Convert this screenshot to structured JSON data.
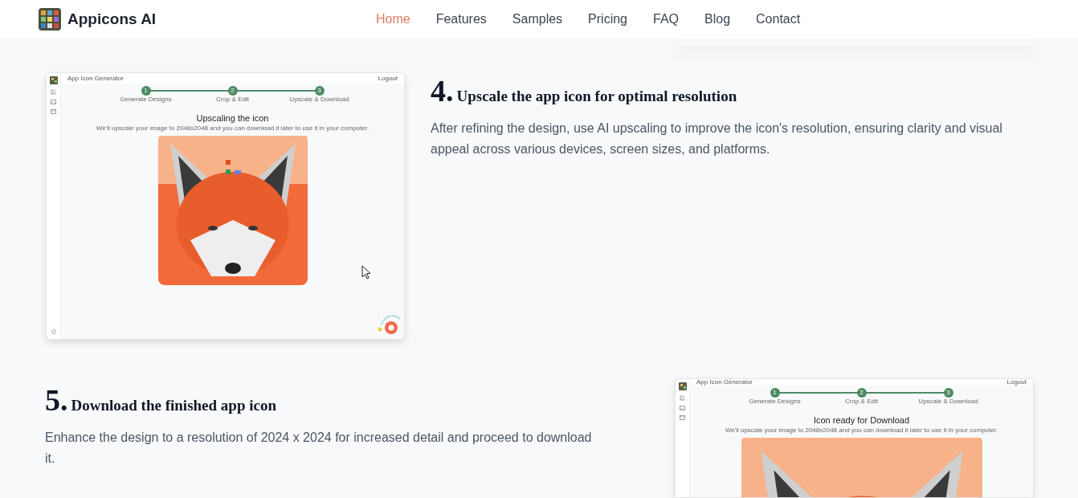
{
  "nav": {
    "brand": "Appicons AI",
    "links": [
      {
        "label": "Home",
        "selected": true
      },
      {
        "label": "Features",
        "selected": false
      },
      {
        "label": "Samples",
        "selected": false
      },
      {
        "label": "Pricing",
        "selected": false
      },
      {
        "label": "FAQ",
        "selected": false
      },
      {
        "label": "Blog",
        "selected": false
      },
      {
        "label": "Contact",
        "selected": false
      }
    ]
  },
  "steps": [
    {
      "number": "4.",
      "title": "Upscale the app icon for optimal resolution",
      "text": "After refining the design, use AI upscaling to improve the icon's resolution, ensuring clarity and visual appeal across various devices, screen sizes, and platforms.",
      "screenshot": {
        "app_title": "App Icon Generator",
        "logout": "Logout",
        "stepper": [
          "Generate Designs",
          "Crop & Edit",
          "Upscale & Download"
        ],
        "step_numbers": [
          "1",
          "2",
          "3"
        ],
        "heading": "Upscaling the icon",
        "subheading": "We'll upscale your image to 2048x2048 and you can download it later to use it in your computer.",
        "cursor": true,
        "badge": true
      }
    },
    {
      "number": "5.",
      "title": "Download the finished app icon",
      "text": "Enhance the design to a resolution of 2024 x 2024 for increased detail and proceed to download it.",
      "screenshot": {
        "app_title": "App Icon Generator",
        "logout": "Logout",
        "stepper": [
          "Generate Designs",
          "Crop & Edit",
          "Upscale & Download"
        ],
        "step_numbers": [
          "1",
          "2",
          "3"
        ],
        "heading": "Icon ready for Download",
        "subheading": "We'll upscale your image to 2048x2048 and you can download it later to use it in your computer.",
        "cursor": false,
        "badge": false
      }
    }
  ]
}
